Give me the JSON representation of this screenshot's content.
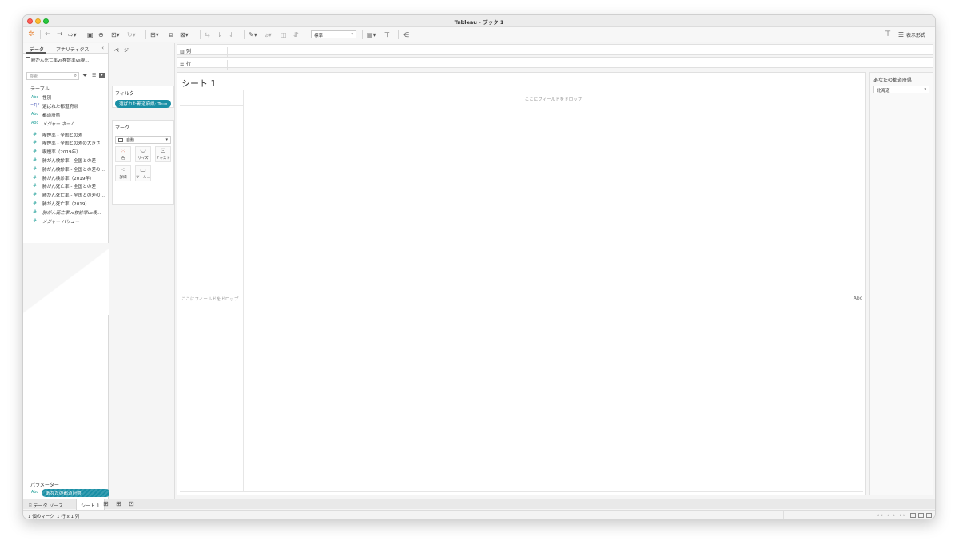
{
  "window": {
    "title": "Tableau - ブック 1"
  },
  "toolbar": {
    "mark_type_select": "標準",
    "display_format_label": "表示形式"
  },
  "left_pane": {
    "tabs": [
      "データ",
      "アナリティクス"
    ],
    "data_source": "肺がん死亡率vs検診率vs喫...",
    "search_placeholder": "検索",
    "tables_heading": "テーブル",
    "dimensions": [
      {
        "type": "Abc",
        "name": "性別"
      },
      {
        "type": "=T|F",
        "name": "選ばれた都道府県"
      },
      {
        "type": "Abc",
        "name": "都道府県"
      },
      {
        "type": "Abc",
        "name": "メジャー ネーム",
        "italic": true
      }
    ],
    "measures": [
      {
        "type": "#",
        "name": "喫煙率 - 全国との差"
      },
      {
        "type": "#",
        "name": "喫煙率 - 全国との差の大きさ"
      },
      {
        "type": "#",
        "name": "喫煙率（2019年）"
      },
      {
        "type": "#",
        "name": "肺がん検診率 - 全国との差"
      },
      {
        "type": "#",
        "name": "肺がん検診率 - 全国との差の..."
      },
      {
        "type": "#",
        "name": "肺がん検診率（2019年）"
      },
      {
        "type": "#",
        "name": "肺がん死亡率 - 全国との差"
      },
      {
        "type": "#",
        "name": "肺がん死亡率 - 全国との差の..."
      },
      {
        "type": "#",
        "name": "肺がん死亡率（2019）"
      },
      {
        "type": "#",
        "name": "肺がん死亡率vs検診率vs喫...",
        "italic": true
      },
      {
        "type": "#",
        "name": "メジャー バリュー",
        "italic": true
      }
    ],
    "parameters_heading": "パラメーター",
    "parameter": {
      "type": "Abc",
      "name": "あなたの都道府県"
    }
  },
  "cards": {
    "pages_title": "ページ",
    "filters_title": "フィルター",
    "filter_pill": "選ばれた都道府県: True",
    "marks_title": "マーク",
    "marks_type": "自動",
    "mark_buttons": {
      "color": "色",
      "size": "サイズ",
      "text": "テキスト",
      "detail": "詳細",
      "tooltip": "ツール..."
    }
  },
  "shelves": {
    "columns": "列",
    "rows": "行"
  },
  "sheet": {
    "title": "シート 1",
    "drop_column": "ここにフィールドをドロップ",
    "drop_row": "ここにフィールドをドロップ",
    "placeholder": "Abc"
  },
  "param_panel": {
    "title": "あなたの都道府県",
    "value": "北海道"
  },
  "bottom_tabs": {
    "data_source": "データ ソース",
    "sheet": "シート 1"
  },
  "status": {
    "marks": "1 個のマーク",
    "rows_cols": "1 行 x 1 列"
  }
}
